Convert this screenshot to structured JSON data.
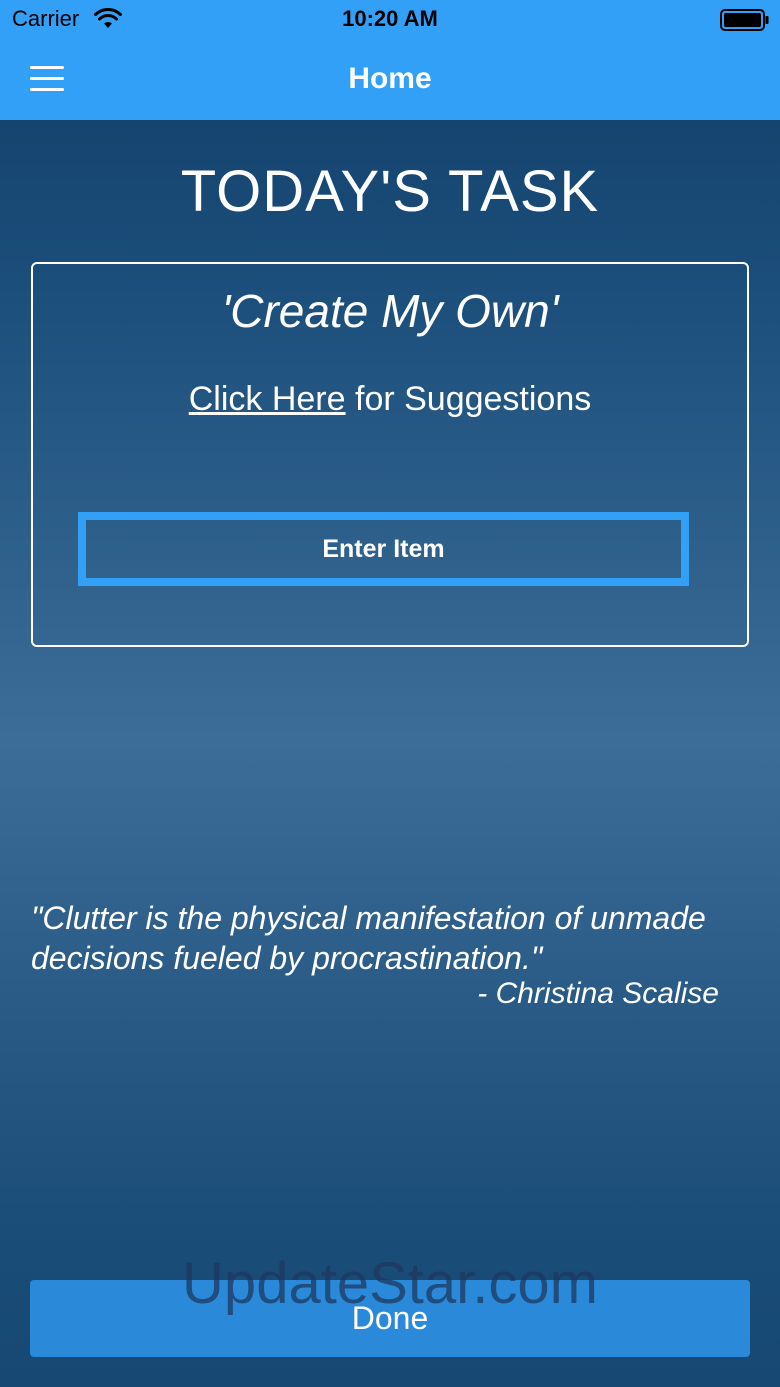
{
  "status_bar": {
    "carrier": "Carrier",
    "time": "10:20 AM"
  },
  "nav": {
    "title": "Home"
  },
  "main": {
    "title": "TODAY'S TASK",
    "task_name": "'Create My Own'",
    "suggestions_link": "Click Here",
    "suggestions_suffix": " for Suggestions",
    "enter_item_label": "Enter Item"
  },
  "quote": {
    "text": "\"Clutter is the physical manifestation of unmade decisions fueled by procrastination.\"",
    "author": "- Christina Scalise"
  },
  "footer": {
    "done_label": "Done",
    "watermark": "UpdateStar.com"
  },
  "colors": {
    "accent": "#31a0f6",
    "done_button": "#2a8ad9",
    "background_top": "#0f3d66",
    "background_mid": "#3c6d98"
  },
  "icons": {
    "menu": "hamburger-menu-icon",
    "wifi": "wifi-icon",
    "battery": "battery-icon"
  }
}
